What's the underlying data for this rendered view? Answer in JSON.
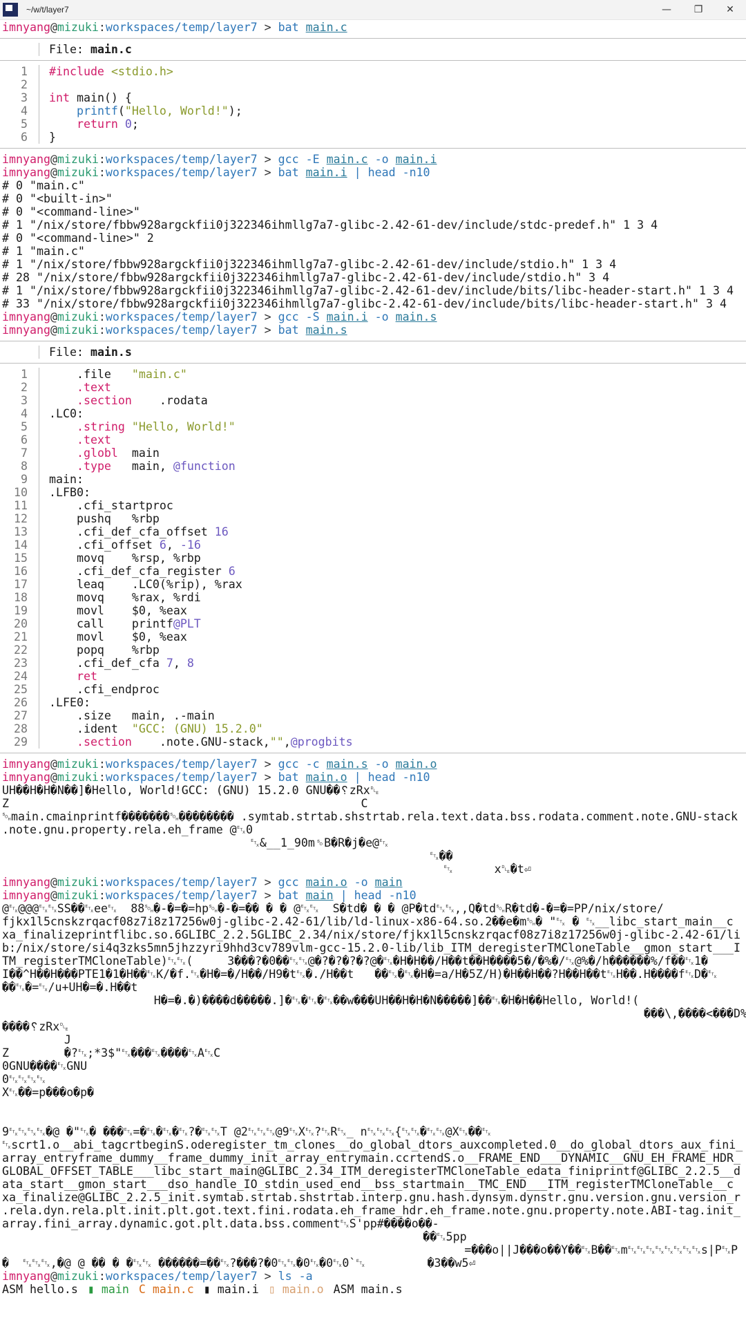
{
  "window": {
    "title": "~/w/t/layer7",
    "controls": [
      "—",
      "❐",
      "✕"
    ]
  },
  "prompt": {
    "user": "imnyang",
    "at": "@",
    "host": "mizuki",
    "sep": ":",
    "dir": "workspaces/temp/layer7",
    "arrow": " > "
  },
  "commands": {
    "c1": [
      "bat",
      "main.c"
    ],
    "c2": [
      "gcc",
      "-E",
      "main.c",
      "-o",
      "main.i"
    ],
    "c3": [
      "bat",
      "main.i",
      "|",
      "head",
      "-n10"
    ],
    "c4": [
      "gcc",
      "-S",
      "main.i",
      "-o",
      "main.s"
    ],
    "c5": [
      "bat",
      "main.s"
    ],
    "c6": [
      "gcc",
      "-c",
      "main.s",
      "-o",
      "main.o"
    ],
    "c7": [
      "bat",
      "main.o",
      "|",
      "head",
      "-n10"
    ],
    "c8": [
      "gcc",
      "main.o",
      "-o",
      "main"
    ],
    "c9": [
      "bat",
      "main",
      "|",
      "head",
      "-n10"
    ],
    "c10": [
      "ls",
      "-a"
    ]
  },
  "bat_c": {
    "file_label": "File: ",
    "file_name": "main.c",
    "lines": [
      "#include <stdio.h>",
      "",
      "int main() {",
      "    printf(\"Hello, World!\");",
      "    return 0;",
      "}"
    ]
  },
  "preproc": [
    "# 0 \"main.c\"",
    "# 0 \"<built-in>\"",
    "# 0 \"<command-line>\"",
    "# 1 \"/nix/store/fbbw928argckfii0j322346ihmllg7a7-glibc-2.42-61-dev/include/stdc-predef.h\" 1 3 4",
    "# 0 \"<command-line>\" 2",
    "# 1 \"main.c\"",
    "# 1 \"/nix/store/fbbw928argckfii0j322346ihmllg7a7-glibc-2.42-61-dev/include/stdio.h\" 1 3 4",
    "# 28 \"/nix/store/fbbw928argckfii0j322346ihmllg7a7-glibc-2.42-61-dev/include/stdio.h\" 3 4",
    "# 1 \"/nix/store/fbbw928argckfii0j322346ihmllg7a7-glibc-2.42-61-dev/include/bits/libc-header-start.h\" 1 3 4",
    "# 33 \"/nix/store/fbbw928argckfii0j322346ihmllg7a7-glibc-2.42-61-dev/include/bits/libc-header-start.h\" 3 4"
  ],
  "bat_s": {
    "file_label": "File: ",
    "file_name": "main.s",
    "lines": [
      "    .file   \"main.c\"",
      "    .text",
      "    .section    .rodata",
      ".LC0:",
      "    .string \"Hello, World!\"",
      "    .text",
      "    .globl  main",
      "    .type   main, @function",
      "main:",
      ".LFB0:",
      "    .cfi_startproc",
      "    pushq   %rbp",
      "    .cfi_def_cfa_offset 16",
      "    .cfi_offset 6, -16",
      "    movq    %rsp, %rbp",
      "    .cfi_def_cfa_register 6",
      "    leaq    .LC0(%rip), %rax",
      "    movq    %rax, %rdi",
      "    movl    $0, %eax",
      "    call    printf@PLT",
      "    movl    $0, %eax",
      "    popq    %rbp",
      "    .cfi_def_cfa 7, 8",
      "    ret",
      "    .cfi_endproc",
      ".LFE0:",
      "    .size   main, .-main",
      "    .ident  \"GCC: (GNU) 15.2.0\"",
      "    .section    .note.GNU-stack,\"\",@progbits"
    ]
  },
  "obj_dump": [
    "UH��H�H�N��]�Hello, World!GCC: (GNU) 15.2.0 GNU��␦zRx␐",
    "Z                                                   C",
    "␁main.cmainprintf�������␁�������� .symtab.strtab.shstrtab.rela.text.data.bss.rodata.comment.note.GNU-stack",
    ".note.gnu.property.rela.eh_frame @␃0",
    "                                    ␃&__1_90m␎B�R�j�e@␃",
    "                                                              ␃��",
    "                                                                ␃      x␐�t⏎"
  ],
  "exe_dump": [
    "@␃@@@␃␃SS��␃ee␃  88␁�-�=�=hp␁�-�=�� � � @␃␃  S�td� � � @P�td␃␃,,Q�td␁R�td�-�=�=PP/nix/store/",
    "fjkx1l5cnskzrqacf08z7i8z17256w0j-glibc-2.42-61/lib/ld-linux-x86-64.so.2��e�m␁� \"␃ � ␃__libc_start_main__c",
    "xa_finalizeprintflibc.so.6GLIBC_2.2.5GLIBC_2.34/nix/store/fjkx1l5cnskzrqacf08z7i8z17256w0j-glibc-2.42-61/li",
    "b:/nix/store/si4q3zks5mn5jhzzyri9hhd3cv789vlm-gcc-15.2.0-lib/lib_ITM_deregisterTMCloneTable__gmon_start___I",
    "TM_registerTMCloneTable)␃␃(     3���?�0��␃␃@�?�?�?�?@�␃�H�H��/H��t��H����5�/�%�/␃@%�/h������%/f��␃1�",
    "I��^H��H���PTE1�1�H��␃K/�f.␃�H�=�/H��/H9�t␃�./H��t   ��␃�␃�H�=a/H�5Z/H)�H��H��?H��H��t␃H��.H����f␃D�␃",
    "��␃�=␃/u+UH�=�.H��t",
    "                      H�=�.�)����d�����.]�␃�␃�␃��w���UH��H�H�N�����]��␃�H�H��Hello, World!(",
    "                                                                                             ���\\,����<���D%",
    "����␦zRx␐",
    "         J",
    "Z        �?␃;*3$\"␃���␃����␃A␃C",
    "0GNU����␃GNU",
    "0␃␃␃␃",
    "X␃��=p���o�p�",
    "",
    "",
    "9␃␃␃␃�@ �\"␃� ���␃=�␃�␃�␃?�␃␃T @2␃␃␃@9␃X␃?␃R␃_ n␃␃␃{␃␃�␃␃@X␃��␃",
    "␃scrt1.o__abi_tagcrtbeginS.oderegister_tm_clones__do_global_dtors_auxcompleted.0__do_global_dtors_aux_fini_",
    "array_entryframe_dummy__frame_dummy_init_array_entrymain.ccrtendS.o__FRAME_END___DYNAMIC__GNU_EH_FRAME_HDR_",
    "GLOBAL_OFFSET_TABLE___libc_start_main@GLIBC_2.34_ITM_deregisterTMCloneTable_edata_finiprintf@GLIBC_2.2.5__d",
    "ata_start__gmon_start___dso_handle_IO_stdin_used_end__bss_startmain__TMC_END___ITM_registerTMCloneTable__c",
    "xa_finalize@GLIBC_2.2.5_init.symtab.strtab.shstrtab.interp.gnu.hash.dynsym.dynstr.gnu.version.gnu.version_r",
    ".rela.dyn.rela.plt.init.plt.got.text.fini.rodata.eh_frame_hdr.eh_frame.note.gnu.property.note.ABI-tag.init_",
    "array.fini_array.dynamic.got.plt.data.bss.comment␃S'pp#����o��-",
    "                                                             ��␃5pp",
    "                                                                   =���o||J���o��Y��␃B��␃m␃␃␃␃␃␃␃␃s|P␃P",
    "�  ␃␃␃,�@ @ �� � �␃␃ ������=��␃?���?�0␃␃�0␃�0␃0`␃         �3��w5⏎"
  ],
  "ls": [
    {
      "icon": "ASM",
      "name": "hello.s",
      "color": "#1a1a1a"
    },
    {
      "icon": "▮",
      "name": "main",
      "color": "#2a9a40"
    },
    {
      "icon": "C",
      "name": "main.c",
      "color": "#d86d1a"
    },
    {
      "icon": "▮",
      "name": "main.i",
      "color": "#1a1a1a"
    },
    {
      "icon": "▯",
      "name": "main.o",
      "color": "#d8a070"
    },
    {
      "icon": "ASM",
      "name": "main.s",
      "color": "#1a1a1a"
    }
  ]
}
